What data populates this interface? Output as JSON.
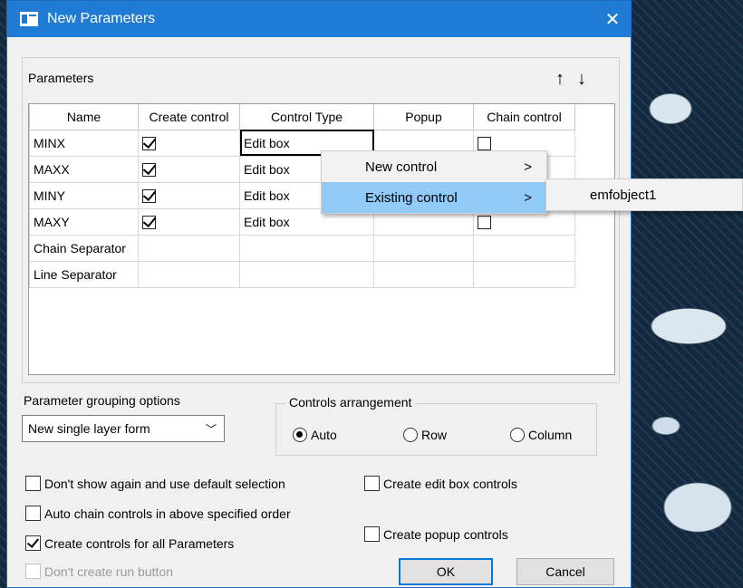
{
  "window": {
    "title": "New Parameters",
    "close_glyph": "✕"
  },
  "parameters_group": {
    "label": "Parameters",
    "up_arrow": "↑",
    "down_arrow": "↓"
  },
  "grid": {
    "columns": [
      "Name",
      "Create control",
      "Control Type",
      "Popup",
      "Chain control"
    ],
    "rows": [
      {
        "name": "MINX",
        "create": true,
        "type": "Edit box",
        "chain": false
      },
      {
        "name": "MAXX",
        "create": true,
        "type": "Edit box",
        "chain": false
      },
      {
        "name": "MINY",
        "create": true,
        "type": "Edit box",
        "chain": false
      },
      {
        "name": "MAXY",
        "create": true,
        "type": "Edit box",
        "chain": false
      },
      {
        "name": "Chain Separator"
      },
      {
        "name": "Line Separator"
      }
    ]
  },
  "grouping": {
    "label": "Parameter grouping options",
    "selected": "New single layer form",
    "chevron": "﹀"
  },
  "arrangement": {
    "legend": "Controls arrangement",
    "options": [
      "Auto",
      "Row",
      "Column"
    ],
    "selected": "Auto"
  },
  "checkboxes": {
    "dont_show": {
      "label": "Don't show again and use default selection",
      "checked": false
    },
    "auto_chain": {
      "label": "Auto chain controls in above specified order",
      "checked": false
    },
    "create_all": {
      "label": "Create controls for all Parameters",
      "checked": true
    },
    "no_run": {
      "label": "Don't create run button",
      "checked": false,
      "disabled": true
    },
    "edit_box": {
      "label": "Create edit box controls",
      "checked": false
    },
    "popup": {
      "label": "Create popup controls",
      "checked": false
    }
  },
  "buttons": {
    "ok": "OK",
    "cancel": "Cancel"
  },
  "context_menu": {
    "items": [
      {
        "label": "New control",
        "arrow": ">"
      },
      {
        "label": "Existing control",
        "arrow": ">"
      }
    ],
    "submenu": {
      "items": [
        "emfobject1"
      ]
    }
  }
}
